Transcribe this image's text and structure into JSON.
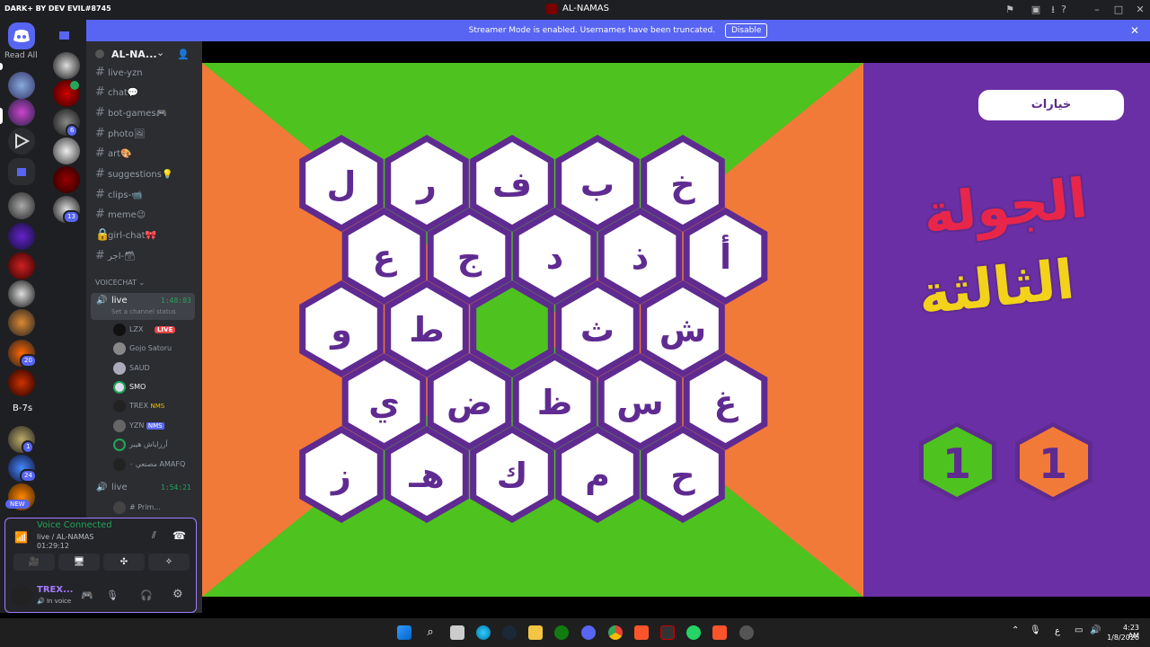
{
  "titlebar": {
    "brand": "DARK+ BY DEV EVIL#8745",
    "title": "AL-NAMAS"
  },
  "rail": {
    "read_all": "Read All",
    "server_b7s": "B-7s",
    "new_badge": "NEW",
    "badges": [
      "6",
      "13",
      "20",
      "1",
      "24"
    ]
  },
  "banner": {
    "text": "Streamer Mode is enabled. Usernames have been truncated.",
    "disable": "Disable"
  },
  "server": {
    "name": "AL-NA...",
    "chevron": "⌄"
  },
  "channels": [
    {
      "name": "live-yzn",
      "emoji": ""
    },
    {
      "name": "chat",
      "emoji": "💬"
    },
    {
      "name": "bot-games",
      "emoji": "🎮"
    },
    {
      "name": "photo",
      "emoji": "🖼"
    },
    {
      "name": "art",
      "emoji": "🎨"
    },
    {
      "name": "suggestions",
      "emoji": "💡"
    },
    {
      "name": "clips-",
      "emoji": "📹"
    },
    {
      "name": "meme",
      "emoji": "😉"
    },
    {
      "name": "girl-chat",
      "emoji": "🎀"
    },
    {
      "name": "اجر-",
      "emoji": "🗃"
    }
  ],
  "voice": {
    "category": "VOICECHAT",
    "live1": {
      "name": "live",
      "time": "1:48:03",
      "status": "Set a channel status"
    },
    "users": [
      "LZX",
      "Gojo Satoru",
      "SAUD",
      "SMO",
      "TREX",
      "YZN",
      "أرزاياش هيبر",
      "مصنعي ۰ AMAFQ"
    ],
    "live_badge": "LIVE",
    "nms": "NMS",
    "live2": {
      "name": "live",
      "time": "1:54:21"
    },
    "user_prim": "# Prim..."
  },
  "voice_panel": {
    "status": "Voice Connected",
    "channel": "live / AL-NAMAS",
    "timer": "01:29:12",
    "user": "TREX...",
    "sub": "In voice"
  },
  "game": {
    "options_label": "خيارات",
    "title_line1": "الجولة",
    "title_line2": "الثالثة",
    "score_green": "1",
    "score_orange": "1",
    "rows": [
      [
        "ل",
        "ر",
        "ف",
        "ب",
        "خ"
      ],
      [
        "ع",
        "ج",
        "د",
        "ذ",
        "أ"
      ],
      [
        "و",
        "ط",
        "",
        "ث",
        "ش"
      ],
      [
        "ي",
        "ض",
        "ظ",
        "س",
        "غ"
      ],
      [
        "ز",
        "هـ",
        "ك",
        "م",
        "ح"
      ]
    ],
    "colors": {
      "green": "#4ec21f",
      "orange": "#f27a38",
      "purple": "#6a2fa5",
      "hex_border": "#5f2b91",
      "red": "#e8264a",
      "yellow": "#f2d21b"
    }
  },
  "taskbar": {
    "lang": "ع",
    "time": "4:23 AM",
    "date": "1/8/2026"
  }
}
